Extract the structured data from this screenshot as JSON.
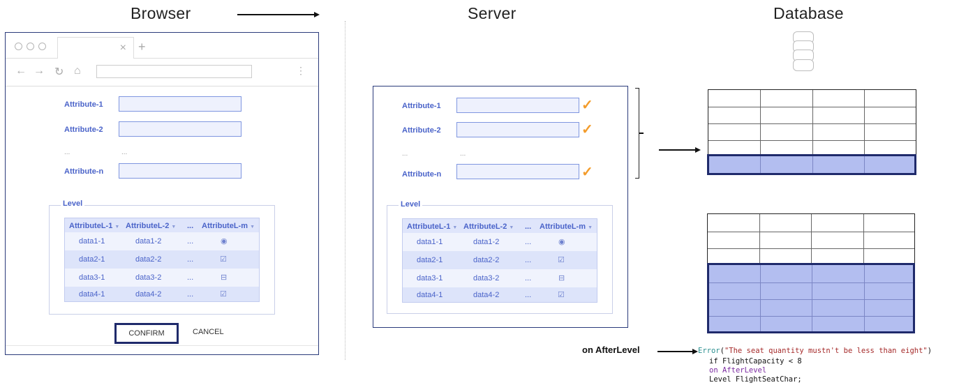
{
  "headings": {
    "browser": "Browser",
    "server": "Server",
    "database": "Database"
  },
  "form": {
    "attributes": [
      "Attribute-1",
      "Attribute-2",
      "...",
      "Attribute-n"
    ],
    "ellipsis_field": "...",
    "level": {
      "legend": "Level",
      "columns": [
        "AttributeL-1",
        "AttributeL-2",
        "...",
        "AttributeL-m"
      ],
      "rows": [
        {
          "c1": "data1-1",
          "c2": "data1-2",
          "c3": "...",
          "icon": "radio-icon"
        },
        {
          "c1": "data2-1",
          "c2": "data2-2",
          "c3": "...",
          "icon": "checkbox-checked-icon"
        },
        {
          "c1": "data3-1",
          "c2": "data3-2",
          "c3": "...",
          "icon": "minus-box-icon"
        },
        {
          "c1": "data4-1",
          "c2": "data4-2",
          "c3": "...",
          "icon": "checkbox-checked-icon"
        }
      ]
    }
  },
  "buttons": {
    "confirm": "CONFIRM",
    "cancel": "CANCEL"
  },
  "browser_chrome": {
    "tab_close": "×",
    "tab_new": "+",
    "menu": "⋮"
  },
  "event_label": "on AfterLevel",
  "code": {
    "line1_fn": "Error",
    "line1_str": "\"The seat quantity mustn't be less than eight\"",
    "line2": "if FlightCapacity < 8",
    "line3_kw": "on",
    "line3_name": "AfterLevel",
    "line4": "Level FlightSeatChar;"
  },
  "colors": {
    "accent": "#4a63c9",
    "highlight_fill": "#b3bef0",
    "highlight_border": "#1f2a6b",
    "check": "#f39c2b"
  }
}
